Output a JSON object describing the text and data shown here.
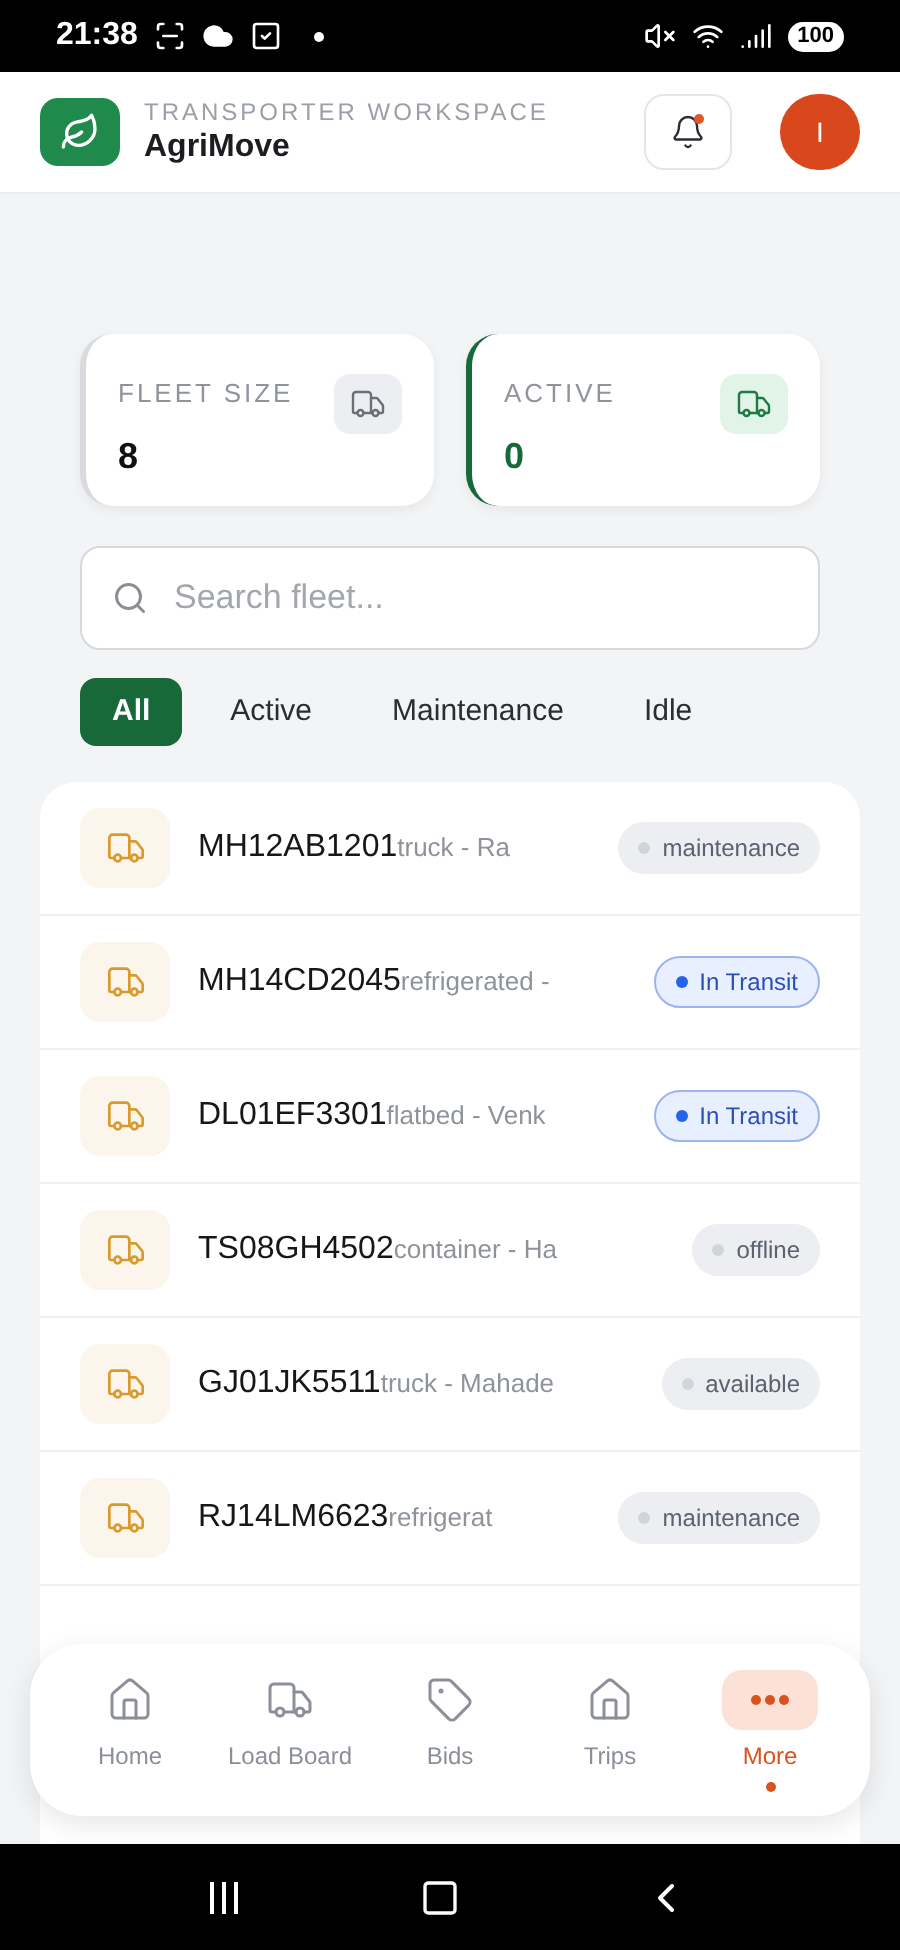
{
  "status_bar": {
    "time": "21:38",
    "battery": "100"
  },
  "header": {
    "subtitle": "TRANSPORTER WORKSPACE",
    "title": "AgriMove",
    "avatar": "I",
    "notification": true
  },
  "stats": [
    {
      "label": "FLEET SIZE",
      "value": "8",
      "kind": "neutral"
    },
    {
      "label": "ACTIVE",
      "value": "0",
      "kind": "green"
    }
  ],
  "search": {
    "placeholder": "Search fleet..."
  },
  "filters": [
    {
      "label": "All",
      "selected": true
    },
    {
      "label": "Active",
      "selected": false
    },
    {
      "label": "Maintenance",
      "selected": false
    },
    {
      "label": "Idle",
      "selected": false
    }
  ],
  "vehicles": [
    {
      "plate": "MH12AB1201",
      "detail": "truck - Ra",
      "status": "maintenance",
      "kind": "grey",
      "color": "#d1d5db"
    },
    {
      "plate": "MH14CD2045",
      "detail": "refrigerated -",
      "status": "In Transit",
      "kind": "blue",
      "color": "#2563eb"
    },
    {
      "plate": "DL01EF3301",
      "detail": "flatbed - Venk",
      "status": "In Transit",
      "kind": "blue",
      "color": "#2563eb"
    },
    {
      "plate": "TS08GH4502",
      "detail": "container - Ha",
      "status": "offline",
      "kind": "grey",
      "color": "#d1d5db"
    },
    {
      "plate": "GJ01JK5511",
      "detail": "truck - Mahade",
      "status": "available",
      "kind": "grey",
      "color": "#d1d5db"
    },
    {
      "plate": "RJ14LM6623",
      "detail": "refrigerat",
      "status": "maintenance",
      "kind": "grey",
      "color": "#d1d5db"
    }
  ],
  "nav": [
    {
      "label": "Home",
      "kind": "home",
      "selected": false
    },
    {
      "label": "Load Board",
      "kind": "truck",
      "selected": false
    },
    {
      "label": "Bids",
      "kind": "tag",
      "selected": false
    },
    {
      "label": "Trips",
      "kind": "home",
      "selected": false
    },
    {
      "label": "More",
      "kind": "dots",
      "selected": true
    }
  ]
}
